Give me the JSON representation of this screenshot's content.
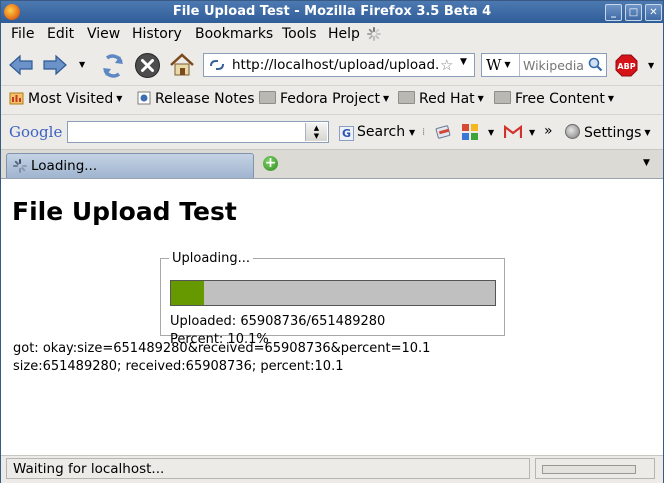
{
  "window": {
    "title": "File Upload Test - Mozilla Firefox 3.5 Beta 4"
  },
  "menu": [
    "File",
    "Edit",
    "View",
    "History",
    "Bookmarks",
    "Tools",
    "Help"
  ],
  "nav": {
    "url": "http://localhost/upload/upload.",
    "search_engine": "W",
    "search_placeholder": "Wikipedia"
  },
  "bookmarks": {
    "most_visited": "Most Visited",
    "release_notes": "Release Notes",
    "fedora_project": "Fedora Project",
    "red_hat": "Red Hat",
    "free_content": "Free Content"
  },
  "google_toolbar": {
    "logo": "Google",
    "search_label": "Search",
    "settings_label": "Settings",
    "more": "»"
  },
  "tab": {
    "label": "Loading..."
  },
  "content": {
    "heading": "File Upload Test",
    "legend": "Uploading...",
    "progress_fraction": 0.101,
    "uploaded": "Uploaded: 65908736/651489280",
    "percent": "Percent: 10.1%",
    "got_line": "got: okay:size=651489280&received=65908736&percent=10.1",
    "summary_line": "size:651489280; received:65908736; percent:10.1"
  },
  "status": {
    "text": "Waiting for localhost..."
  },
  "colors": {
    "progress_fill": "#669900",
    "progress_track": "#c0c0c0",
    "titlebar": "#3b6aa5"
  }
}
